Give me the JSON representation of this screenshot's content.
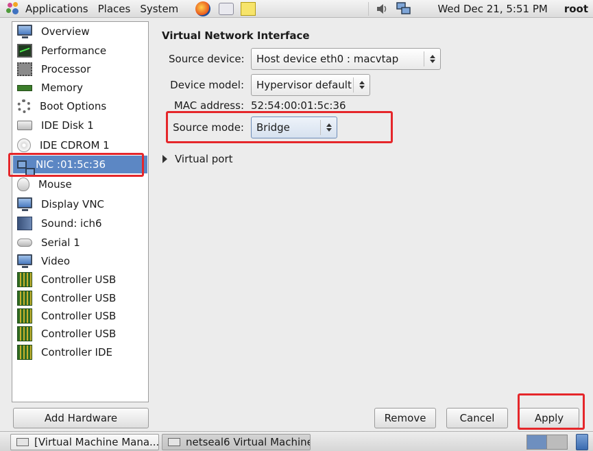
{
  "top_panel": {
    "menus": [
      "Applications",
      "Places",
      "System"
    ],
    "clock": "Wed Dec 21,  5:51 PM",
    "user": "root"
  },
  "hardware_list": {
    "items": [
      {
        "label": "Overview",
        "icon": "monitor-icon"
      },
      {
        "label": "Performance",
        "icon": "performance-icon"
      },
      {
        "label": "Processor",
        "icon": "cpu-icon"
      },
      {
        "label": "Memory",
        "icon": "memory-icon"
      },
      {
        "label": "Boot Options",
        "icon": "gear-icon"
      },
      {
        "label": "IDE Disk 1",
        "icon": "disk-icon"
      },
      {
        "label": "IDE CDROM 1",
        "icon": "cdrom-icon"
      },
      {
        "label": "NIC :01:5c:36",
        "icon": "network-card-icon"
      },
      {
        "label": "Mouse",
        "icon": "mouse-icon"
      },
      {
        "label": "Display VNC",
        "icon": "monitor-icon"
      },
      {
        "label": "Sound: ich6",
        "icon": "sound-card-icon"
      },
      {
        "label": "Serial 1",
        "icon": "serial-port-icon"
      },
      {
        "label": "Video",
        "icon": "monitor-icon"
      },
      {
        "label": "Controller USB",
        "icon": "controller-icon"
      },
      {
        "label": "Controller USB",
        "icon": "controller-icon"
      },
      {
        "label": "Controller USB",
        "icon": "controller-icon"
      },
      {
        "label": "Controller USB",
        "icon": "controller-icon"
      },
      {
        "label": "Controller IDE",
        "icon": "controller-icon"
      }
    ],
    "selected": "NIC :01:5c:36"
  },
  "detail": {
    "title": "Virtual Network Interface",
    "source_device_label": "Source device:",
    "source_device_value": "Host device eth0 : macvtap",
    "device_model_label": "Device model:",
    "device_model_value": "Hypervisor default",
    "mac_label": "MAC address:",
    "mac_value": "52:54:00:01:5c:36",
    "source_mode_label": "Source mode:",
    "source_mode_value": "Bridge",
    "virtual_port_label": "Virtual port"
  },
  "buttons": {
    "add_hardware": "Add Hardware",
    "remove": "Remove",
    "cancel": "Cancel",
    "apply": "Apply"
  },
  "taskbar": {
    "tasks": [
      "[Virtual Machine Mana...",
      "netseal6 Virtual Machine"
    ]
  },
  "colors": {
    "selection": "#5c87c4",
    "highlight_box": "#e5262a"
  }
}
